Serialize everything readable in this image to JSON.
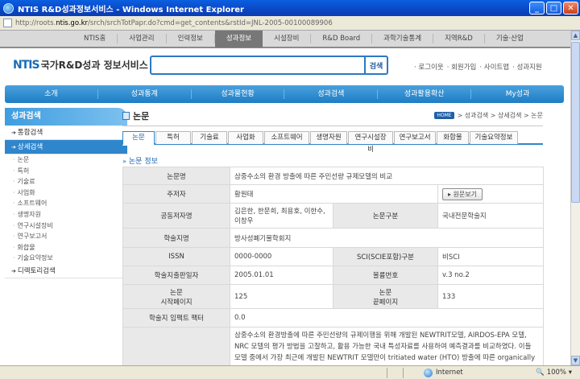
{
  "window": {
    "title": "NTIS R&D성과정보서비스 - Windows Internet Explorer",
    "url_prefix": "http://roots.",
    "url_domain": "ntis.go.kr",
    "url_rest": "/srch/srchTotPapr.do?cmd=get_contents&rstId=JNL-2005-00100089906"
  },
  "topmenu": [
    "NTIS홈",
    "사업관리",
    "인력정보",
    "성과정보",
    "시설장비",
    "R&D Board",
    "과학기술통계",
    "지역R&D",
    "기술·산업"
  ],
  "topmenu_active": 3,
  "header": {
    "logo_mark": "NTIS",
    "logo_name": "국가R&D성과 정보서비스",
    "search_button": "검색",
    "util_links": [
      "· 로그이웃",
      "· 회원가입",
      "· 사이트맵",
      "· 성과지원"
    ]
  },
  "mainnav": [
    "소개",
    "성과통계",
    "성과물현황",
    "성과검색",
    "성과활용확산",
    "My성과"
  ],
  "sidebar": {
    "title": "성과검색",
    "sec1": "통합검색",
    "sec2": "상세검색",
    "items": [
      "논문",
      "특허",
      "기술료",
      "사업화",
      "소프트웨어",
      "생명자원",
      "연구시설장비",
      "연구보고서",
      "화합물",
      "기술요약정보"
    ],
    "sec3": "디렉토리검색"
  },
  "content": {
    "title": "논문",
    "breadcrumb_home": "HOME",
    "breadcrumb": "> 성과검색 > 상세검색 > 논문",
    "tabs": [
      "논문",
      "특허",
      "기술료",
      "사업화",
      "소프트웨어",
      "생명자원",
      "연구시설장비",
      "연구보고서",
      "화합물",
      "기술요약정보"
    ],
    "tab_active": 0,
    "sub_title": "논문 정보",
    "table": {
      "paper_name_label": "논문명",
      "paper_name": "삼중수소의 환경 방출에 따른 주민선량 규제모델의 비교",
      "author_label": "주저자",
      "author": "황원태",
      "orig_button": "▸ 원문보기",
      "coauthor_label": "공동저자명",
      "coauthor": "김은한, 한문희, 최용호, 이한수, 이창우",
      "type_label": "논문구분",
      "type": "국내전문학술지",
      "journal_label": "학술지명",
      "journal": "방사성폐기물학회지",
      "issn_label": "ISSN",
      "issn": "0000-0000",
      "sci_label": "SCI(SCIE포함)구분",
      "sci": "비SCI",
      "pubdate_label": "학술지출판일자",
      "pubdate": "2005.01.01",
      "volume_label": "볼륨번호",
      "volume": "v.3 no.2",
      "startpage_label_1": "논문",
      "startpage_label_2": "시작페이지",
      "startpage": "125",
      "endpage_label_1": "논문",
      "endpage_label_2": "끝페이지",
      "endpage": "133",
      "impact_label": "학술지 임팩트 팩터",
      "impact": "0.0",
      "abstract": "삼중수소의 환경방출에 따른 주민선량의 규제이행을 위해 개발된 NEWTRIT모델, AIRDOS-EPA 모델, NRC 모델의 평가 방법을 고찰하고, 활용 가능한 국내 특성자료를 사용하여 예측결과를 비교하였다. 이들 모델 중에서 가장 최근에 개발된 NEWTRIT 모델만이 tritiated water (HTO) 방출에 따른 organically"
    }
  },
  "status": {
    "zone": "Internet",
    "zoom": "100%"
  }
}
